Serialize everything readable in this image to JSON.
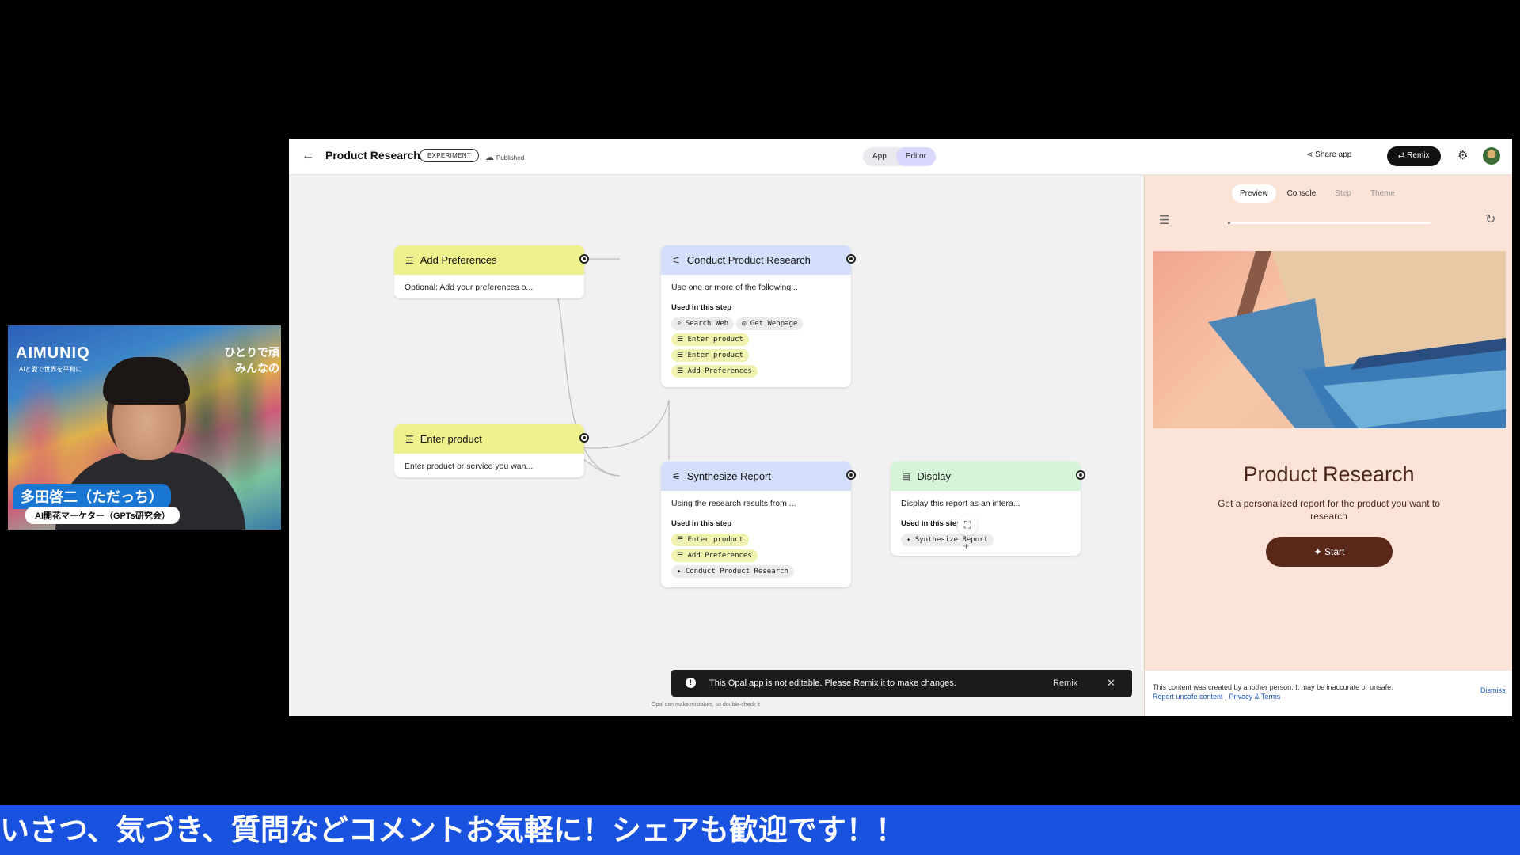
{
  "camera": {
    "brand": "AIMUNIQ",
    "brand_sub": "AIと愛で世界を平和に",
    "tagline_1": "ひとりで頑",
    "tagline_2": "みんなの",
    "name": "多田啓二（ただっち）",
    "role": "AI開花マーケター（GPTs研究会）"
  },
  "topbar": {
    "back": "←",
    "title": "Product Research",
    "badge": "EXPERIMENT",
    "status": "Published",
    "seg_app": "App",
    "seg_editor": "Editor",
    "share": "Share app",
    "remix": "Remix"
  },
  "nodes": {
    "add_prefs": {
      "title": "Add Preferences",
      "body": "Optional: Add your preferences o..."
    },
    "conduct": {
      "title": "Conduct Product Research",
      "body": "Use one or more of the following...",
      "used": "Used in this step",
      "tool_1": "Search Web",
      "tool_2": "Get Webpage",
      "chip_1": "Enter product",
      "chip_2": "Enter product",
      "chip_3": "Add Preferences"
    },
    "enter_product": {
      "title": "Enter product",
      "body": "Enter product or service you wan..."
    },
    "synthesize": {
      "title": "Synthesize Report",
      "body": "Using the research results from ...",
      "used": "Used in this step",
      "chip_1": "Enter product",
      "chip_2": "Add Preferences",
      "chip_3": "Conduct Product Research"
    },
    "display": {
      "title": "Display",
      "body": "Display this report as an intera...",
      "used": "Used in this step",
      "chip_1": "Synthesize Report"
    }
  },
  "toast": {
    "message": "This Opal app is not editable. Please Remix it to make changes.",
    "remix": "Remix",
    "close": "✕"
  },
  "footnote": "Opal can make mistakes, so double-check it",
  "panel": {
    "tabs": [
      "Preview",
      "Console",
      "Step",
      "Theme"
    ],
    "progress": 0.0,
    "title": "Product Research",
    "description": "Get a personalized report for the product you want to research",
    "start": "Start",
    "notice": "This content was created by another person. It may be inaccurate or unsafe.",
    "links": "Report unsafe content · Privacy & Terms",
    "dismiss": "Dismiss"
  },
  "ticker": "いさつ、気づき、質問などコメントお気軽に！シェアも歓迎です！！"
}
